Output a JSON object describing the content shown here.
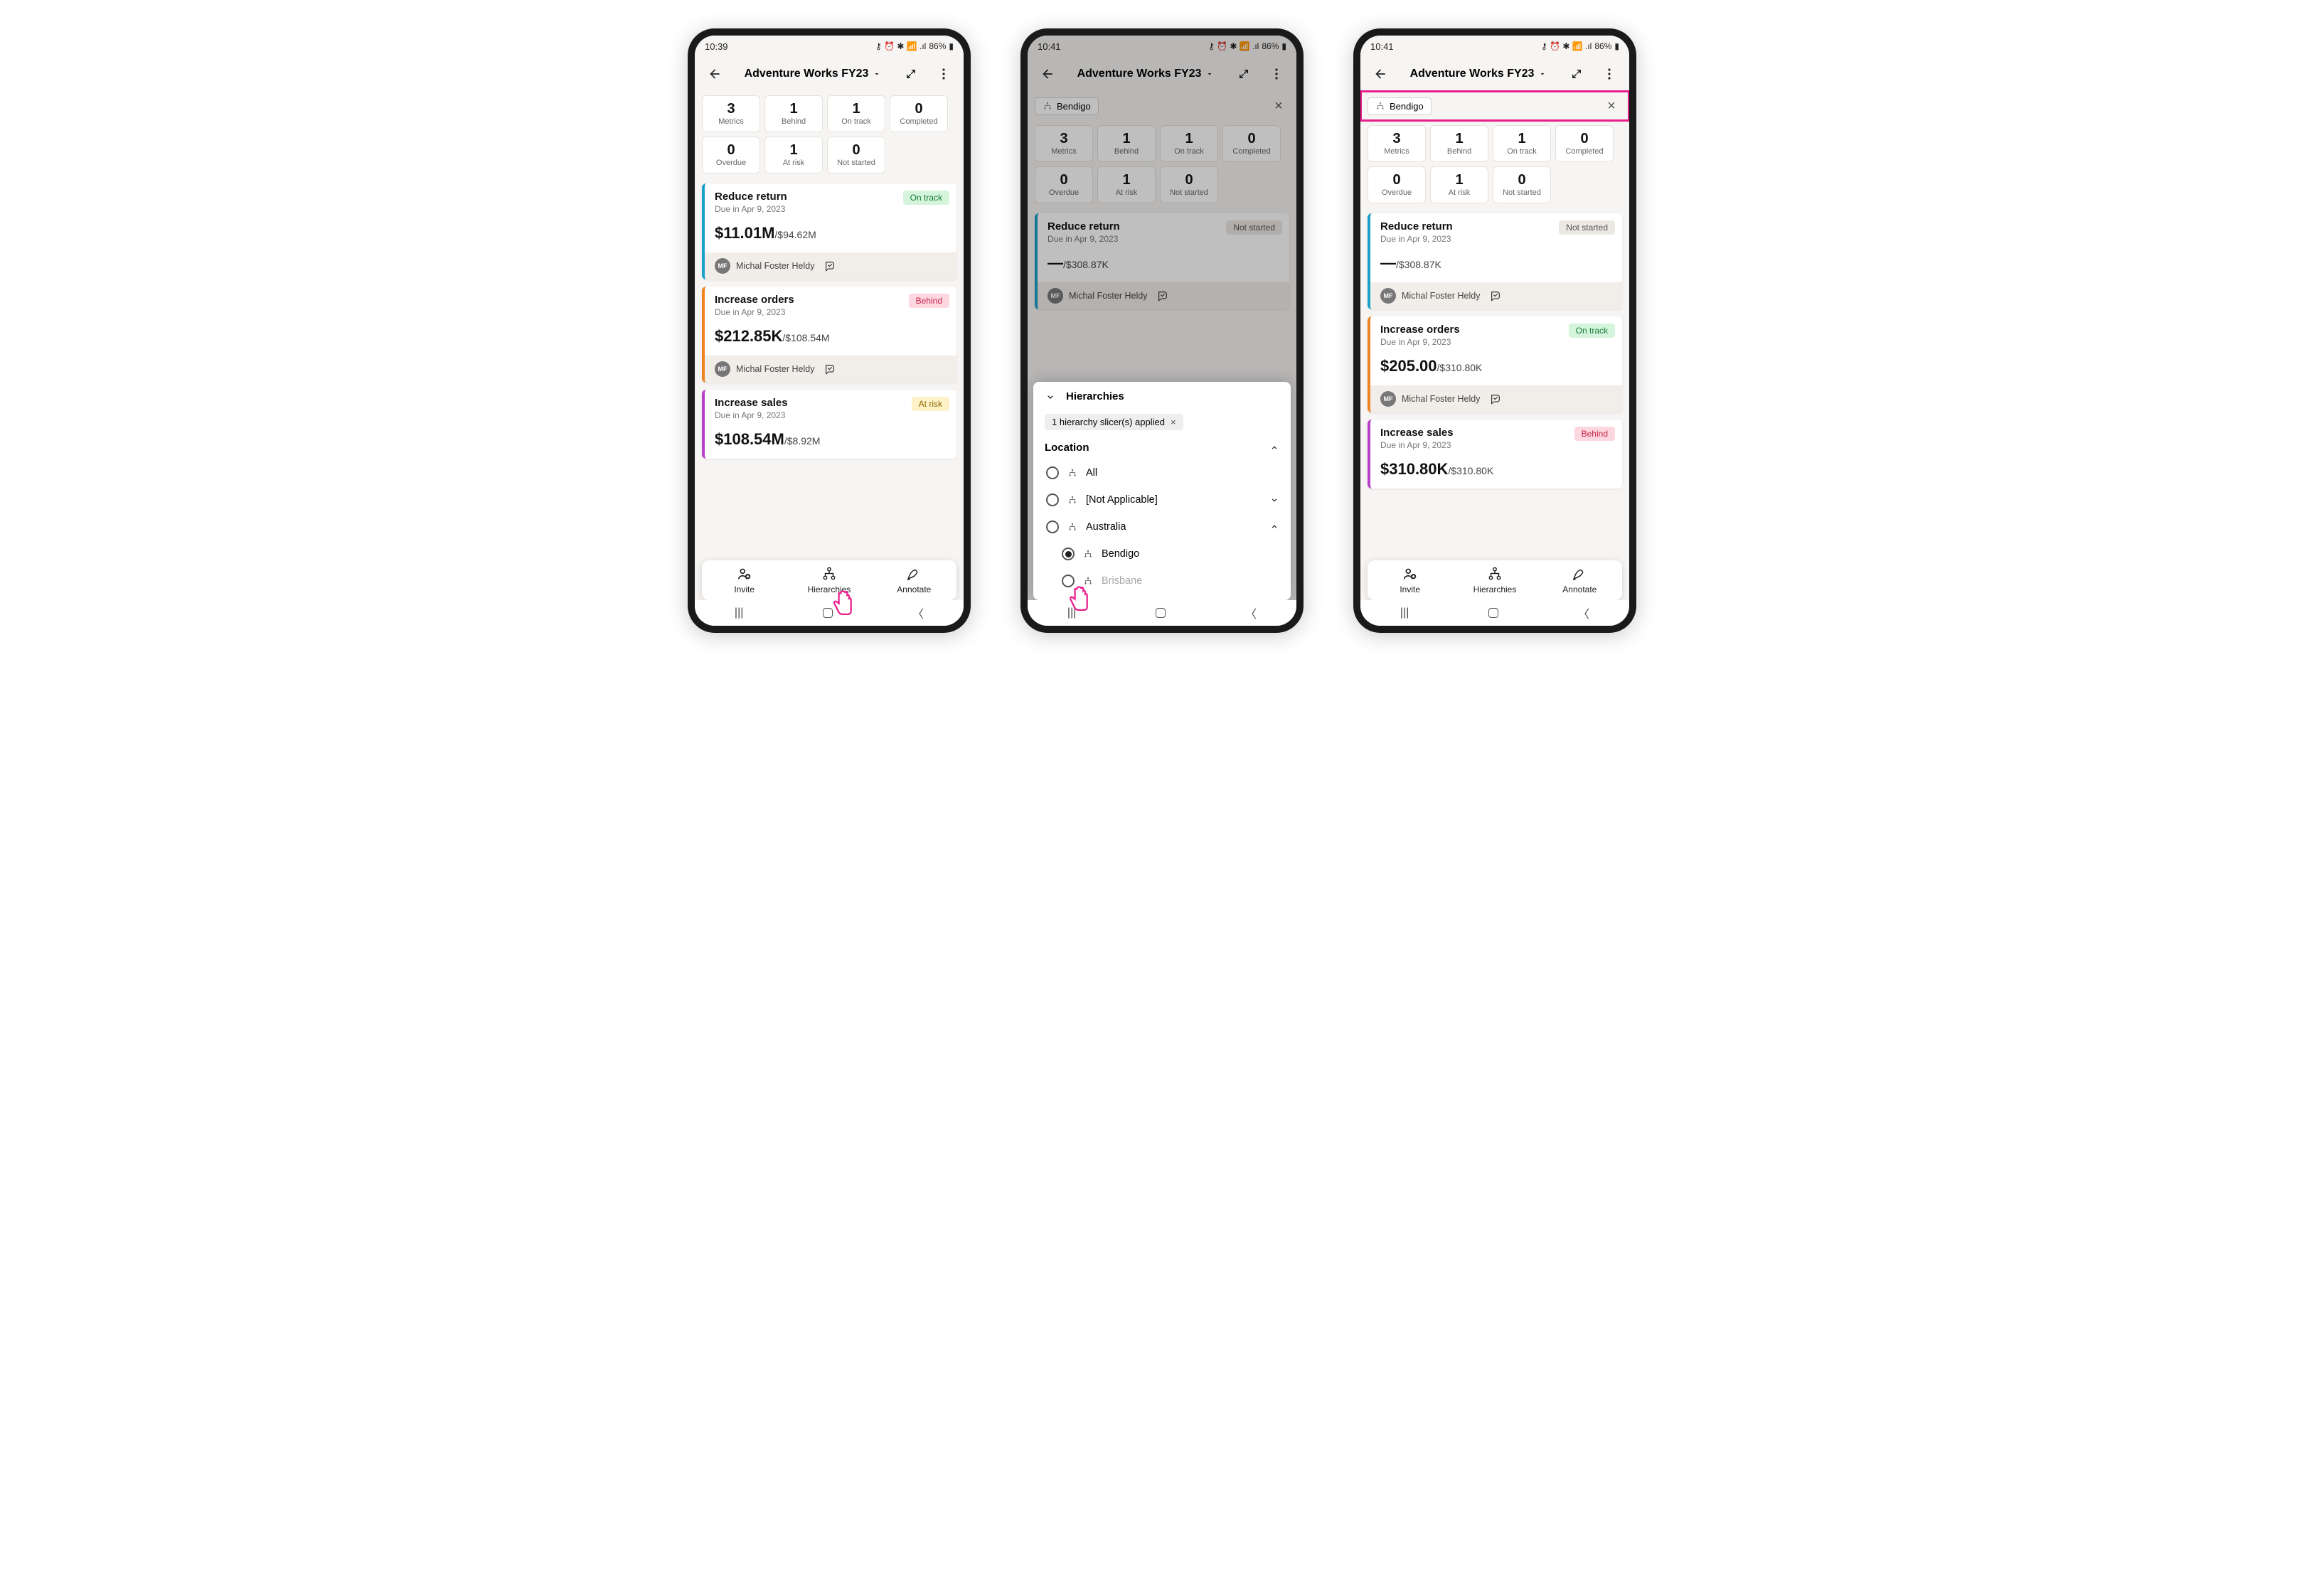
{
  "status_times": [
    "10:39",
    "10:41",
    "10:41"
  ],
  "status_battery": "86%",
  "app_title": "Adventure Works FY23",
  "filter_chip": "Bendigo",
  "kpis_row1": [
    {
      "num": "3",
      "lbl": "Metrics"
    },
    {
      "num": "1",
      "lbl": "Behind"
    },
    {
      "num": "1",
      "lbl": "On track"
    },
    {
      "num": "0",
      "lbl": "Completed"
    }
  ],
  "kpis_row2": [
    {
      "num": "0",
      "lbl": "Overdue"
    },
    {
      "num": "1",
      "lbl": "At risk"
    },
    {
      "num": "0",
      "lbl": "Not started"
    }
  ],
  "owner": {
    "initials": "MF",
    "name": "Michal Foster Heldy"
  },
  "phone1_metrics": [
    {
      "title": "Reduce return",
      "due": "Due in Apr 9, 2023",
      "badge": "On track",
      "badge_cls": "badge-ontrack",
      "big": "$11.01M",
      "small": "/$94.62M",
      "color": "#1aa1c9"
    },
    {
      "title": "Increase orders",
      "due": "Due in Apr 9, 2023",
      "badge": "Behind",
      "badge_cls": "badge-behind",
      "big": "$212.85K",
      "small": "/$108.54M",
      "color": "#f08322"
    },
    {
      "title": "Increase sales",
      "due": "Due in Apr 9, 2023",
      "badge": "At risk",
      "badge_cls": "badge-atrisk",
      "big": "$108.54M",
      "small": "/$8.92M",
      "color": "#b83fc9"
    }
  ],
  "phone2_metric": {
    "title": "Reduce return",
    "due": "Due in Apr 9, 2023",
    "badge": "Not started",
    "badge_cls": "badge-notstarted",
    "big": "—",
    "small": "/$308.87K",
    "color": "#1aa1c9"
  },
  "phone3_metrics": [
    {
      "title": "Reduce return",
      "due": "Due in Apr 9, 2023",
      "badge": "Not started",
      "badge_cls": "badge-notstarted",
      "big": "—",
      "small": "/$308.87K",
      "color": "#1aa1c9"
    },
    {
      "title": "Increase orders",
      "due": "Due in Apr 9, 2023",
      "badge": "On track",
      "badge_cls": "badge-ontrack",
      "big": "$205.00",
      "small": "/$310.80K",
      "color": "#f08322"
    },
    {
      "title": "Increase sales",
      "due": "Due in Apr 9, 2023",
      "badge": "Behind",
      "badge_cls": "badge-behind",
      "big": "$310.80K",
      "small": "/$310.80K",
      "color": "#b83fc9"
    }
  ],
  "actions": [
    {
      "label": "Invite"
    },
    {
      "label": "Hierarchies"
    },
    {
      "label": "Annotate"
    }
  ],
  "panel": {
    "title": "Hierarchies",
    "applied": "1 hierarchy slicer(s) applied",
    "section": "Location",
    "rows": [
      {
        "label": "All",
        "checked": false,
        "indent": false,
        "chevron": ""
      },
      {
        "label": "[Not Applicable]",
        "checked": false,
        "indent": false,
        "chevron": "down"
      },
      {
        "label": "Australia",
        "checked": false,
        "indent": false,
        "chevron": "up"
      },
      {
        "label": "Bendigo",
        "checked": true,
        "indent": true,
        "chevron": ""
      },
      {
        "label": "Brisbane",
        "checked": false,
        "indent": true,
        "chevron": "",
        "partial": true
      }
    ]
  }
}
